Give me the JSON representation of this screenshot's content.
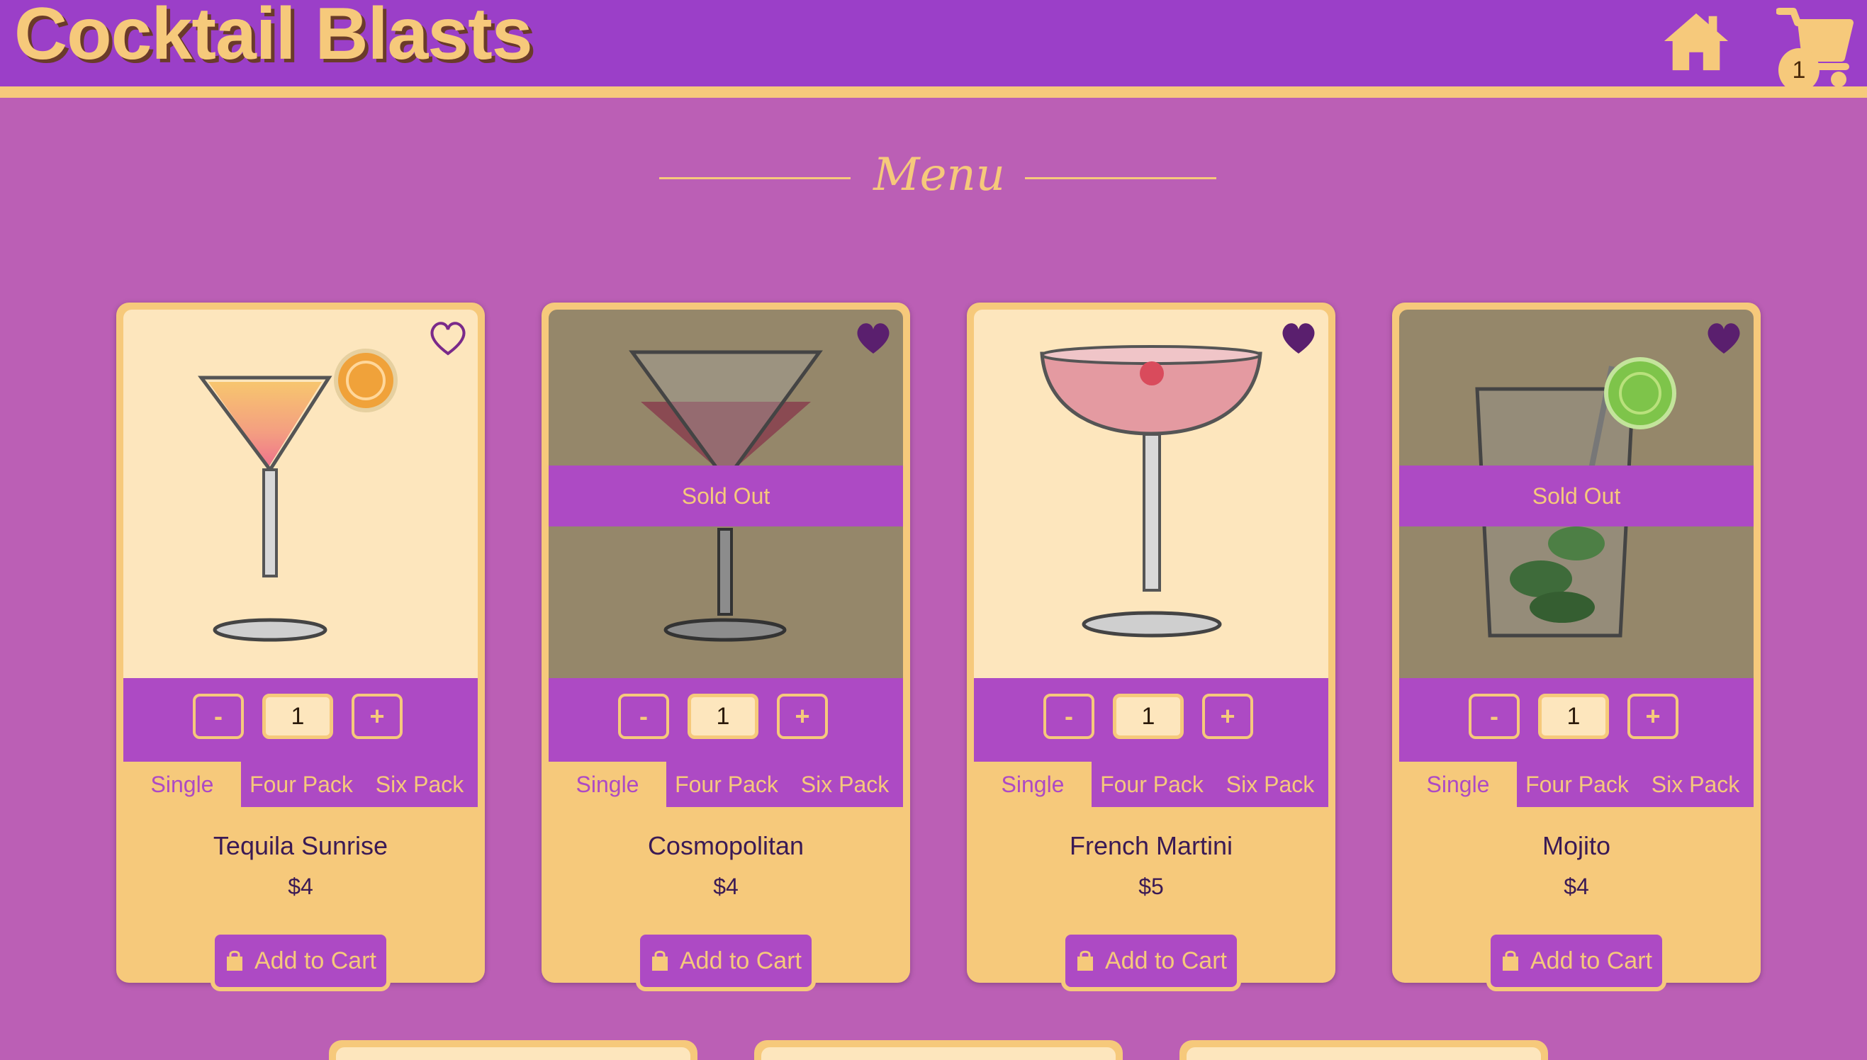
{
  "header": {
    "title": "Cocktail Blasts",
    "cart_count": "1",
    "home_icon": "home-icon",
    "cart_icon": "cart-icon",
    "brand_color": "#f6c97b",
    "bar_color": "#9b3fc8"
  },
  "menu": {
    "title": "Menu"
  },
  "cards": [
    {
      "name": "Tequila Sunrise",
      "price": "$4",
      "qty": "1",
      "favorited": false,
      "sold_out_label": "",
      "options": {
        "minus": "-",
        "plus": "+",
        "single": "Single",
        "four": "Four Pack",
        "six": "Six Pack"
      },
      "add_label": "Add to Cart"
    },
    {
      "name": "Cosmopolitan",
      "price": "$4",
      "qty": "1",
      "favorited": true,
      "sold_out_label": "Sold Out",
      "options": {
        "minus": "-",
        "plus": "+",
        "single": "Single",
        "four": "Four Pack",
        "six": "Six Pack"
      },
      "add_label": "Add to Cart"
    },
    {
      "name": "French Martini",
      "price": "$5",
      "qty": "1",
      "favorited": true,
      "sold_out_label": "",
      "options": {
        "minus": "-",
        "plus": "+",
        "single": "Single",
        "four": "Four Pack",
        "six": "Six Pack"
      },
      "add_label": "Add to Cart"
    },
    {
      "name": "Mojito",
      "price": "$4",
      "qty": "1",
      "favorited": true,
      "sold_out_label": "Sold Out",
      "options": {
        "minus": "-",
        "plus": "+",
        "single": "Single",
        "four": "Four Pack",
        "six": "Six Pack"
      },
      "add_label": "Add to Cart"
    }
  ]
}
